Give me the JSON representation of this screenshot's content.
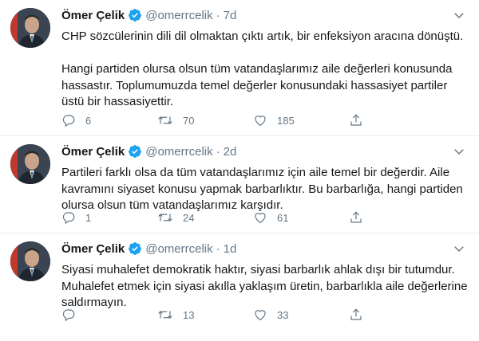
{
  "tweets": [
    {
      "author": "Ömer Çelik",
      "handle": "@omerrcelik",
      "separator": "·",
      "time": "7d",
      "text": "CHP sözcülerinin dili dil olmaktan çıktı artık, bir enfeksiyon aracına dönüştü.\n\nHangi partiden olursa olsun tüm vatandaşlarımız aile değerleri konusunda hassastır. Toplumumuzda temel değerler konusundaki hassasiyet partiler üstü bir hassasiyettir.",
      "replies": "6",
      "retweets": "70",
      "likes": "185"
    },
    {
      "author": "Ömer Çelik",
      "handle": "@omerrcelik",
      "separator": "·",
      "time": "2d",
      "text": "Partileri farklı olsa da tüm vatandaşlarımız için aile temel bir değerdir. Aile kavramını siyaset konusu yapmak barbarlıktır. Bu barbarlığa, hangi partiden olursa olsun tüm vatandaşlarımız karşıdır.",
      "replies": "1",
      "retweets": "24",
      "likes": "61"
    },
    {
      "author": "Ömer Çelik",
      "handle": "@omerrcelik",
      "separator": "·",
      "time": "1d",
      "text": "Siyasi muhalefet demokratik haktır, siyasi barbarlık ahlak dışı bir tutumdur. Muhalefet etmek için siyasi akılla yaklaşım üretin, barbarlıkla aile değerlerine saldırmayın.",
      "replies": "",
      "retweets": "13",
      "likes": "33"
    }
  ],
  "icons": {
    "verified": "verified-badge-icon",
    "more": "chevron-down-icon",
    "reply": "reply-icon",
    "retweet": "retweet-icon",
    "like": "heart-icon",
    "share": "share-icon"
  },
  "colors": {
    "verified": "#1da1f2",
    "muted": "#657786",
    "text": "#14171a",
    "divider": "#e6ecf0"
  }
}
